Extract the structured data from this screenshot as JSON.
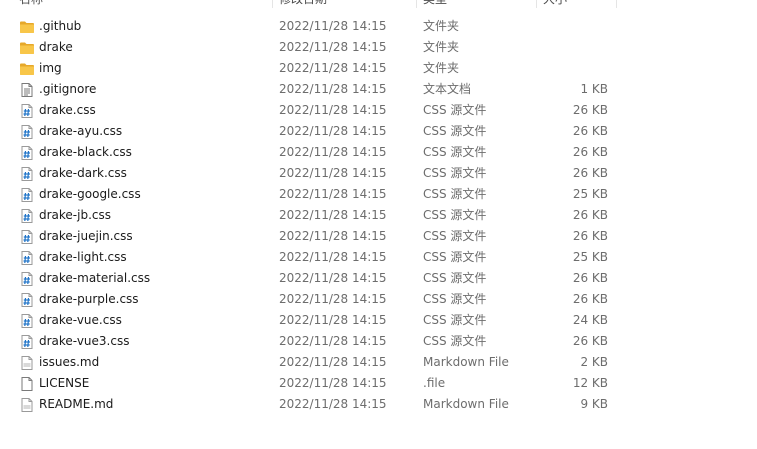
{
  "columns": {
    "name": "名称",
    "date": "修改日期",
    "type": "类型",
    "size": "大小"
  },
  "files": [
    {
      "name": ".github",
      "date": "2022/11/28 14:15",
      "type": "文件夹",
      "size": "",
      "icon": "folder-icon"
    },
    {
      "name": "drake",
      "date": "2022/11/28 14:15",
      "type": "文件夹",
      "size": "",
      "icon": "folder-icon"
    },
    {
      "name": "img",
      "date": "2022/11/28 14:15",
      "type": "文件夹",
      "size": "",
      "icon": "folder-icon"
    },
    {
      "name": ".gitignore",
      "date": "2022/11/28 14:15",
      "type": "文本文档",
      "size": "1 KB",
      "icon": "text-file-icon"
    },
    {
      "name": "drake.css",
      "date": "2022/11/28 14:15",
      "type": "CSS 源文件",
      "size": "26 KB",
      "icon": "css-file-icon"
    },
    {
      "name": "drake-ayu.css",
      "date": "2022/11/28 14:15",
      "type": "CSS 源文件",
      "size": "26 KB",
      "icon": "css-file-icon"
    },
    {
      "name": "drake-black.css",
      "date": "2022/11/28 14:15",
      "type": "CSS 源文件",
      "size": "26 KB",
      "icon": "css-file-icon"
    },
    {
      "name": "drake-dark.css",
      "date": "2022/11/28 14:15",
      "type": "CSS 源文件",
      "size": "26 KB",
      "icon": "css-file-icon"
    },
    {
      "name": "drake-google.css",
      "date": "2022/11/28 14:15",
      "type": "CSS 源文件",
      "size": "25 KB",
      "icon": "css-file-icon"
    },
    {
      "name": "drake-jb.css",
      "date": "2022/11/28 14:15",
      "type": "CSS 源文件",
      "size": "26 KB",
      "icon": "css-file-icon"
    },
    {
      "name": "drake-juejin.css",
      "date": "2022/11/28 14:15",
      "type": "CSS 源文件",
      "size": "26 KB",
      "icon": "css-file-icon"
    },
    {
      "name": "drake-light.css",
      "date": "2022/11/28 14:15",
      "type": "CSS 源文件",
      "size": "25 KB",
      "icon": "css-file-icon"
    },
    {
      "name": "drake-material.css",
      "date": "2022/11/28 14:15",
      "type": "CSS 源文件",
      "size": "26 KB",
      "icon": "css-file-icon"
    },
    {
      "name": "drake-purple.css",
      "date": "2022/11/28 14:15",
      "type": "CSS 源文件",
      "size": "26 KB",
      "icon": "css-file-icon"
    },
    {
      "name": "drake-vue.css",
      "date": "2022/11/28 14:15",
      "type": "CSS 源文件",
      "size": "24 KB",
      "icon": "css-file-icon"
    },
    {
      "name": "drake-vue3.css",
      "date": "2022/11/28 14:15",
      "type": "CSS 源文件",
      "size": "26 KB",
      "icon": "css-file-icon"
    },
    {
      "name": "issues.md",
      "date": "2022/11/28 14:15",
      "type": "Markdown File",
      "size": "2 KB",
      "icon": "markdown-file-icon"
    },
    {
      "name": "LICENSE",
      "date": "2022/11/28 14:15",
      "type": ".file",
      "size": "12 KB",
      "icon": "blank-file-icon"
    },
    {
      "name": "README.md",
      "date": "2022/11/28 14:15",
      "type": "Markdown File",
      "size": "9 KB",
      "icon": "markdown-file-icon"
    }
  ],
  "colors": {
    "folder": "#f8c649",
    "folder_dark": "#e6a82a",
    "css_icon": "#1e73c8",
    "text_primary": "#1a1a1a",
    "text_secondary": "#6d6d6d"
  }
}
